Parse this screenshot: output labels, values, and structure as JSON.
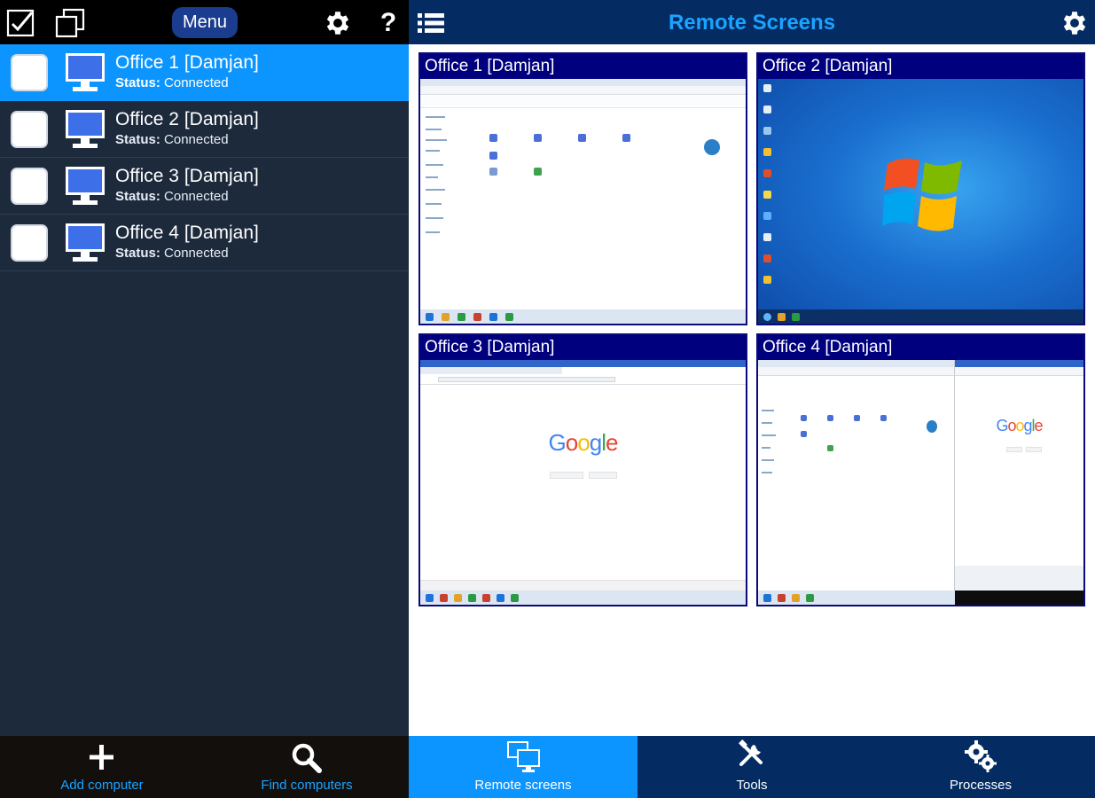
{
  "left_toolbar": {
    "menu_label": "Menu",
    "help_glyph": "?",
    "icons": [
      "select-all-icon",
      "windows-icon",
      "gear-icon",
      "help-icon"
    ]
  },
  "computers": [
    {
      "name": "Office 1 [Damjan]",
      "status_label": "Status:",
      "status": "Connected",
      "selected": true
    },
    {
      "name": "Office 2 [Damjan]",
      "status_label": "Status:",
      "status": "Connected",
      "selected": false
    },
    {
      "name": "Office 3 [Damjan]",
      "status_label": "Status:",
      "status": "Connected",
      "selected": false
    },
    {
      "name": "Office 4 [Damjan]",
      "status_label": "Status:",
      "status": "Connected",
      "selected": false
    }
  ],
  "left_bottom": {
    "add_label": "Add computer",
    "find_label": "Find computers"
  },
  "right_header": {
    "title": "Remote Screens"
  },
  "screens": [
    {
      "title": "Office 1 [Damjan]",
      "content": "file-explorer"
    },
    {
      "title": "Office 2 [Damjan]",
      "content": "windows-7-desktop"
    },
    {
      "title": "Office 3 [Damjan]",
      "content": "browser-google"
    },
    {
      "title": "Office 4 [Damjan]",
      "content": "explorer-and-browser"
    }
  ],
  "screen_thumb_text": {
    "google_logo": "Google"
  },
  "bottom_tabs": [
    {
      "label": "Remote screens",
      "active": true
    },
    {
      "label": "Tools",
      "active": false
    },
    {
      "label": "Processes",
      "active": false
    }
  ],
  "colors": {
    "accent": "#0c95ff",
    "header_blue": "#042c63",
    "tile_header": "#00007f",
    "left_bg": "#1c2a3c",
    "link_blue": "#1aa3ff"
  }
}
